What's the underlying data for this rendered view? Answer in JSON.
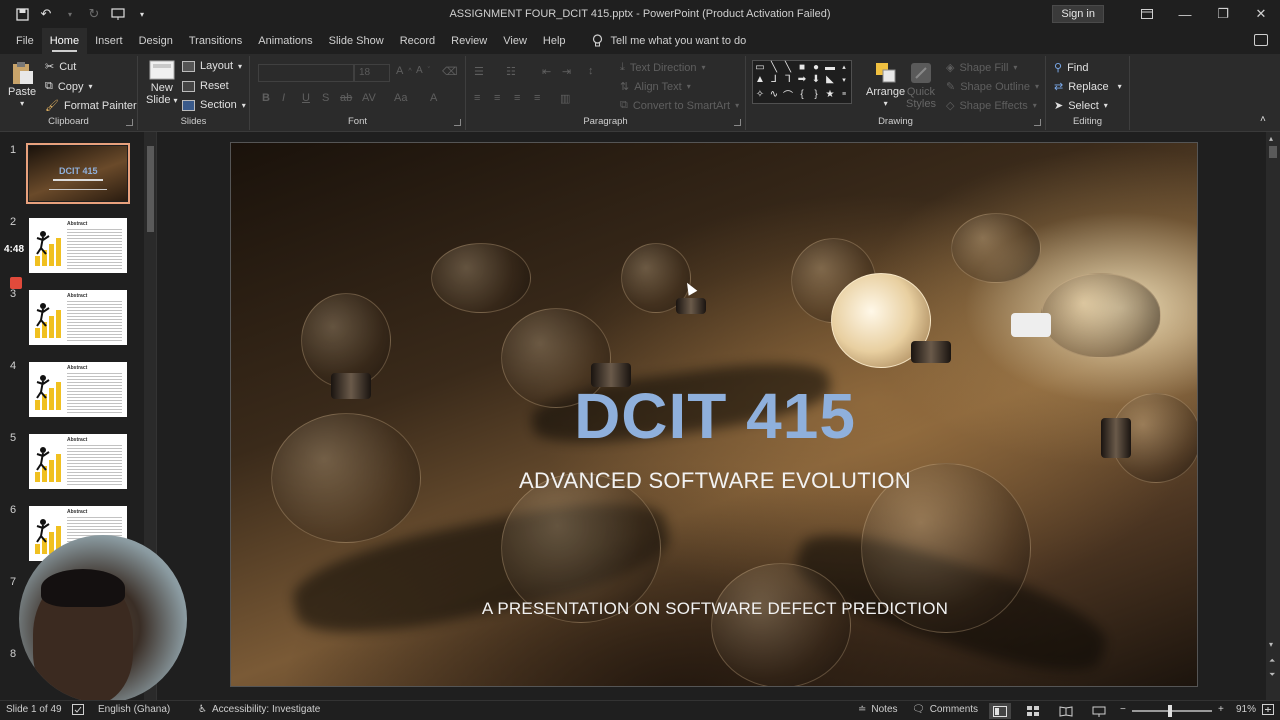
{
  "window": {
    "title": "ASSIGNMENT FOUR_DCIT 415.pptx  -  PowerPoint (Product Activation Failed)",
    "sign_in": "Sign in"
  },
  "tabs": [
    "File",
    "Home",
    "Insert",
    "Design",
    "Transitions",
    "Animations",
    "Slide Show",
    "Record",
    "Review",
    "View",
    "Help"
  ],
  "active_tab": "Home",
  "tell_me": "Tell me what you want to do",
  "ribbon": {
    "clipboard": {
      "label": "Clipboard",
      "paste": "Paste",
      "cut": "Cut",
      "copy": "Copy",
      "format_painter": "Format Painter"
    },
    "slides": {
      "label": "Slides",
      "new_slide_1": "New",
      "new_slide_2": "Slide",
      "layout": "Layout",
      "reset": "Reset",
      "section": "Section"
    },
    "font": {
      "label": "Font",
      "size": "18"
    },
    "paragraph": {
      "label": "Paragraph",
      "text_direction": "Text Direction",
      "align_text": "Align Text",
      "convert_smartart": "Convert to SmartArt"
    },
    "drawing": {
      "label": "Drawing",
      "arrange": "Arrange",
      "quick_styles_1": "Quick",
      "quick_styles_2": "Styles",
      "shape_fill": "Shape Fill",
      "shape_outline": "Shape Outline",
      "shape_effects": "Shape Effects"
    },
    "editing": {
      "label": "Editing",
      "find": "Find",
      "replace": "Replace",
      "select": "Select"
    }
  },
  "thumbnails": {
    "numbers": [
      "1",
      "2",
      "3",
      "4",
      "5",
      "6",
      "7",
      "8"
    ],
    "abstract_title": "Abstract",
    "slide1_title": "DCIT 415",
    "timer": "4:48"
  },
  "slide": {
    "title": "DCIT 415",
    "subtitle": "ADVANCED SOFTWARE EVOLUTION",
    "tagline": "A PRESENTATION ON SOFTWARE DEFECT PREDICTION"
  },
  "status": {
    "slide_of": "Slide 1 of 49",
    "language": "English (Ghana)",
    "accessibility": "Accessibility: Investigate",
    "notes": "Notes",
    "comments": "Comments",
    "zoom": "91%"
  },
  "colors": {
    "title_blue": "#8fb0dc",
    "accent_orange": "#e8a17d",
    "ribbon_bg": "#2b2b2b"
  }
}
